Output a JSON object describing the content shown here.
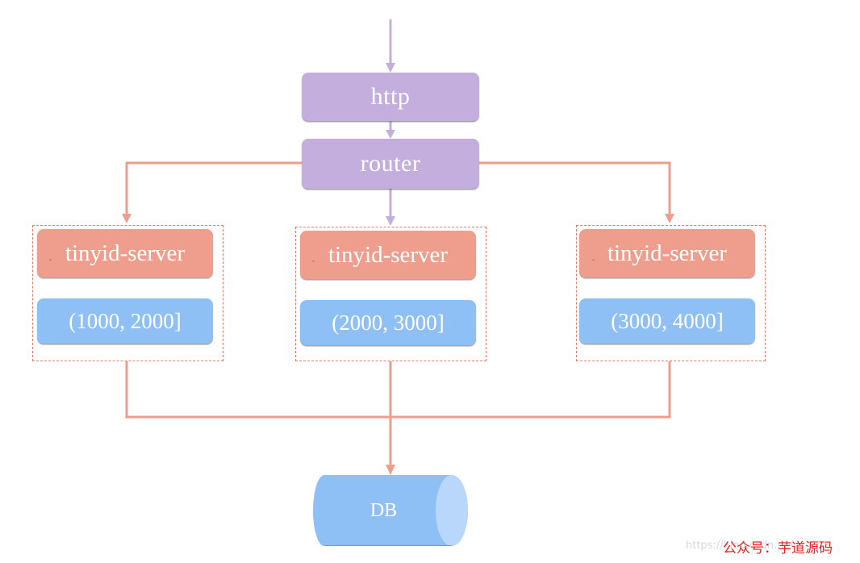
{
  "diagram": {
    "entry": {
      "label": "http"
    },
    "router": {
      "label": "router"
    },
    "servers": [
      {
        "name": "tinyid-server",
        "range": "(1000, 2000]"
      },
      {
        "name": "tinyid-server",
        "range": "(2000, 3000]"
      },
      {
        "name": "tinyid-server",
        "range": "(3000, 4000]"
      }
    ],
    "database": {
      "label": "DB"
    }
  },
  "colors": {
    "purple_node": "#c3aedd",
    "server_node": "#ef9e8d",
    "range_node": "#8ec0f6",
    "arrow_purple": "#c3aedd",
    "arrow_salmon": "#ef9e8d",
    "group_border": "#e57b6d"
  },
  "watermark": {
    "url": "https://blog.csdn.net",
    "text": "公众号：芋道源码"
  }
}
